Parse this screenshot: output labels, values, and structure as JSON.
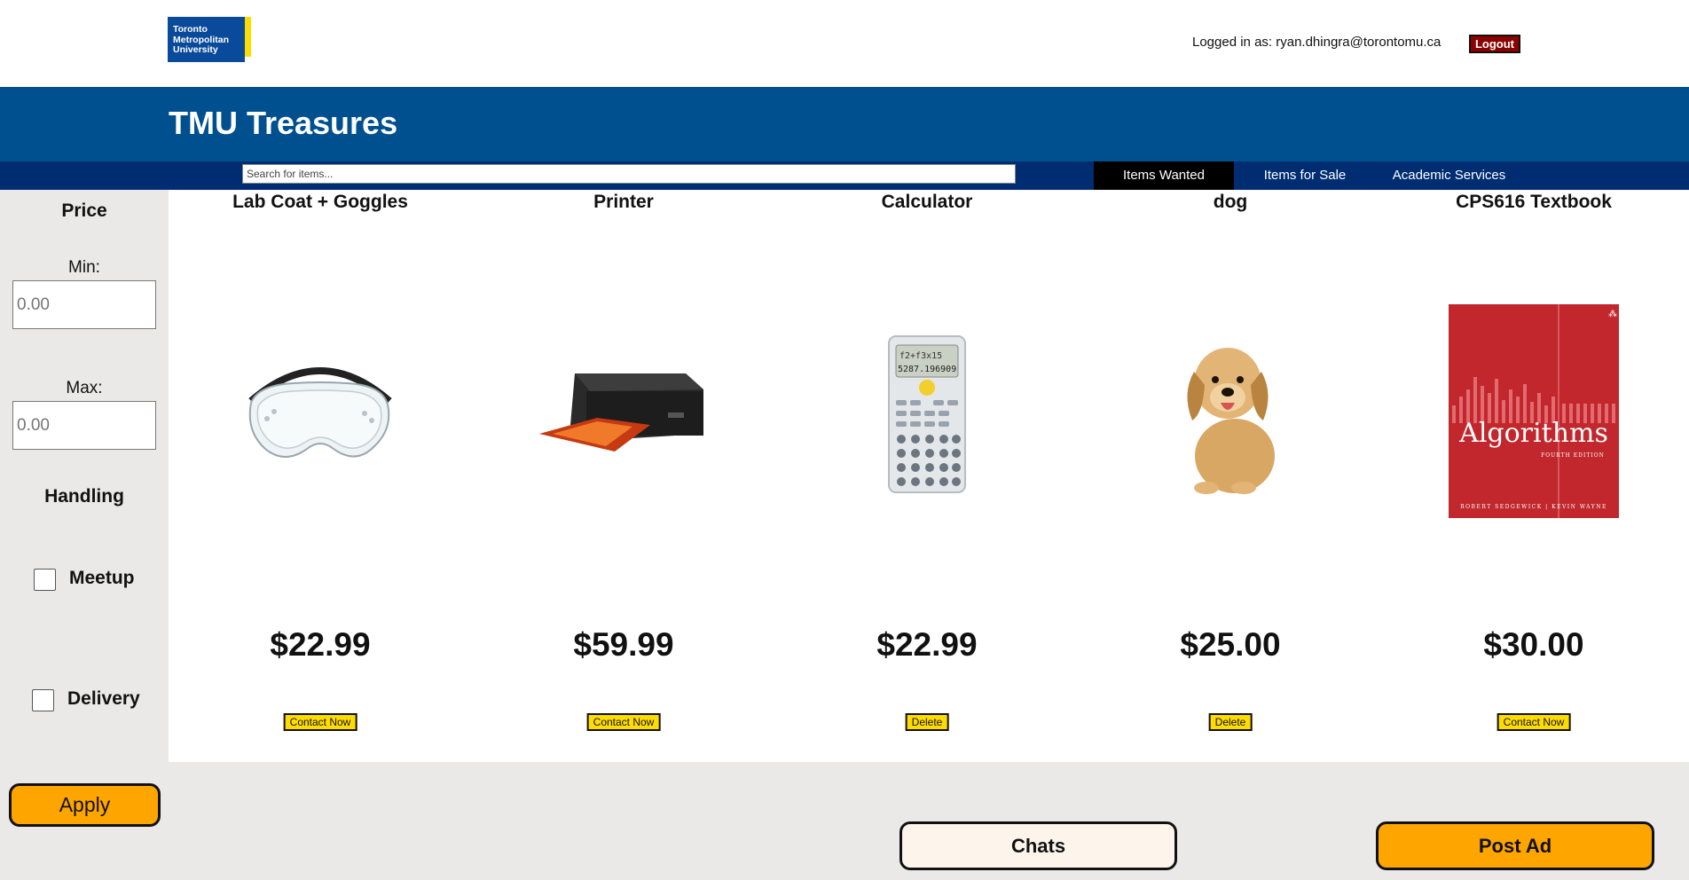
{
  "header": {
    "logo_lines": [
      "Toronto",
      "Metropolitan",
      "University"
    ],
    "login_text": "Logged in as: ryan.dhingra@torontomu.ca",
    "logout_label": "Logout"
  },
  "banner": {
    "title": "TMU Treasures"
  },
  "nav": {
    "search_placeholder": "Search for items...",
    "tabs": [
      {
        "label": "Items Wanted",
        "active": true
      },
      {
        "label": "Items for Sale",
        "active": false
      },
      {
        "label": "Academic Services",
        "active": false
      }
    ]
  },
  "sidebar": {
    "price_title": "Price",
    "min_label": "Min:",
    "min_placeholder": "0.00",
    "max_label": "Max:",
    "max_placeholder": "0.00",
    "handling_title": "Handling",
    "meetup_label": "Meetup",
    "delivery_label": "Delivery",
    "apply_label": "Apply"
  },
  "products": [
    {
      "title": "Lab Coat + Goggles",
      "price": "$22.99",
      "button": "Contact Now",
      "image_icon": "goggles-image"
    },
    {
      "title": "Printer",
      "price": "$59.99",
      "button": "Contact Now",
      "image_icon": "printer-image"
    },
    {
      "title": "Calculator",
      "price": "$22.99",
      "button": "Delete",
      "image_icon": "calculator-image",
      "display": "f2+f3x15",
      "display_value": "5287.196909"
    },
    {
      "title": "dog",
      "price": "$25.00",
      "button": "Delete",
      "image_icon": "puppy-image"
    },
    {
      "title": "CPS616 Textbook",
      "price": "$30.00",
      "button": "Contact Now",
      "image_icon": "textbook-image",
      "book_title": "Algorithms",
      "edition": "FOURTH EDITION",
      "authors": "ROBERT SEDGEWICK | KEVIN WAYNE"
    }
  ],
  "footer": {
    "chats_label": "Chats",
    "post_ad_label": "Post Ad"
  },
  "colors": {
    "banner": "#00508f",
    "navbar": "#002d72",
    "accent_orange": "#ffa500",
    "button_yellow": "#ffdc00",
    "logout_red": "#8b0000"
  }
}
